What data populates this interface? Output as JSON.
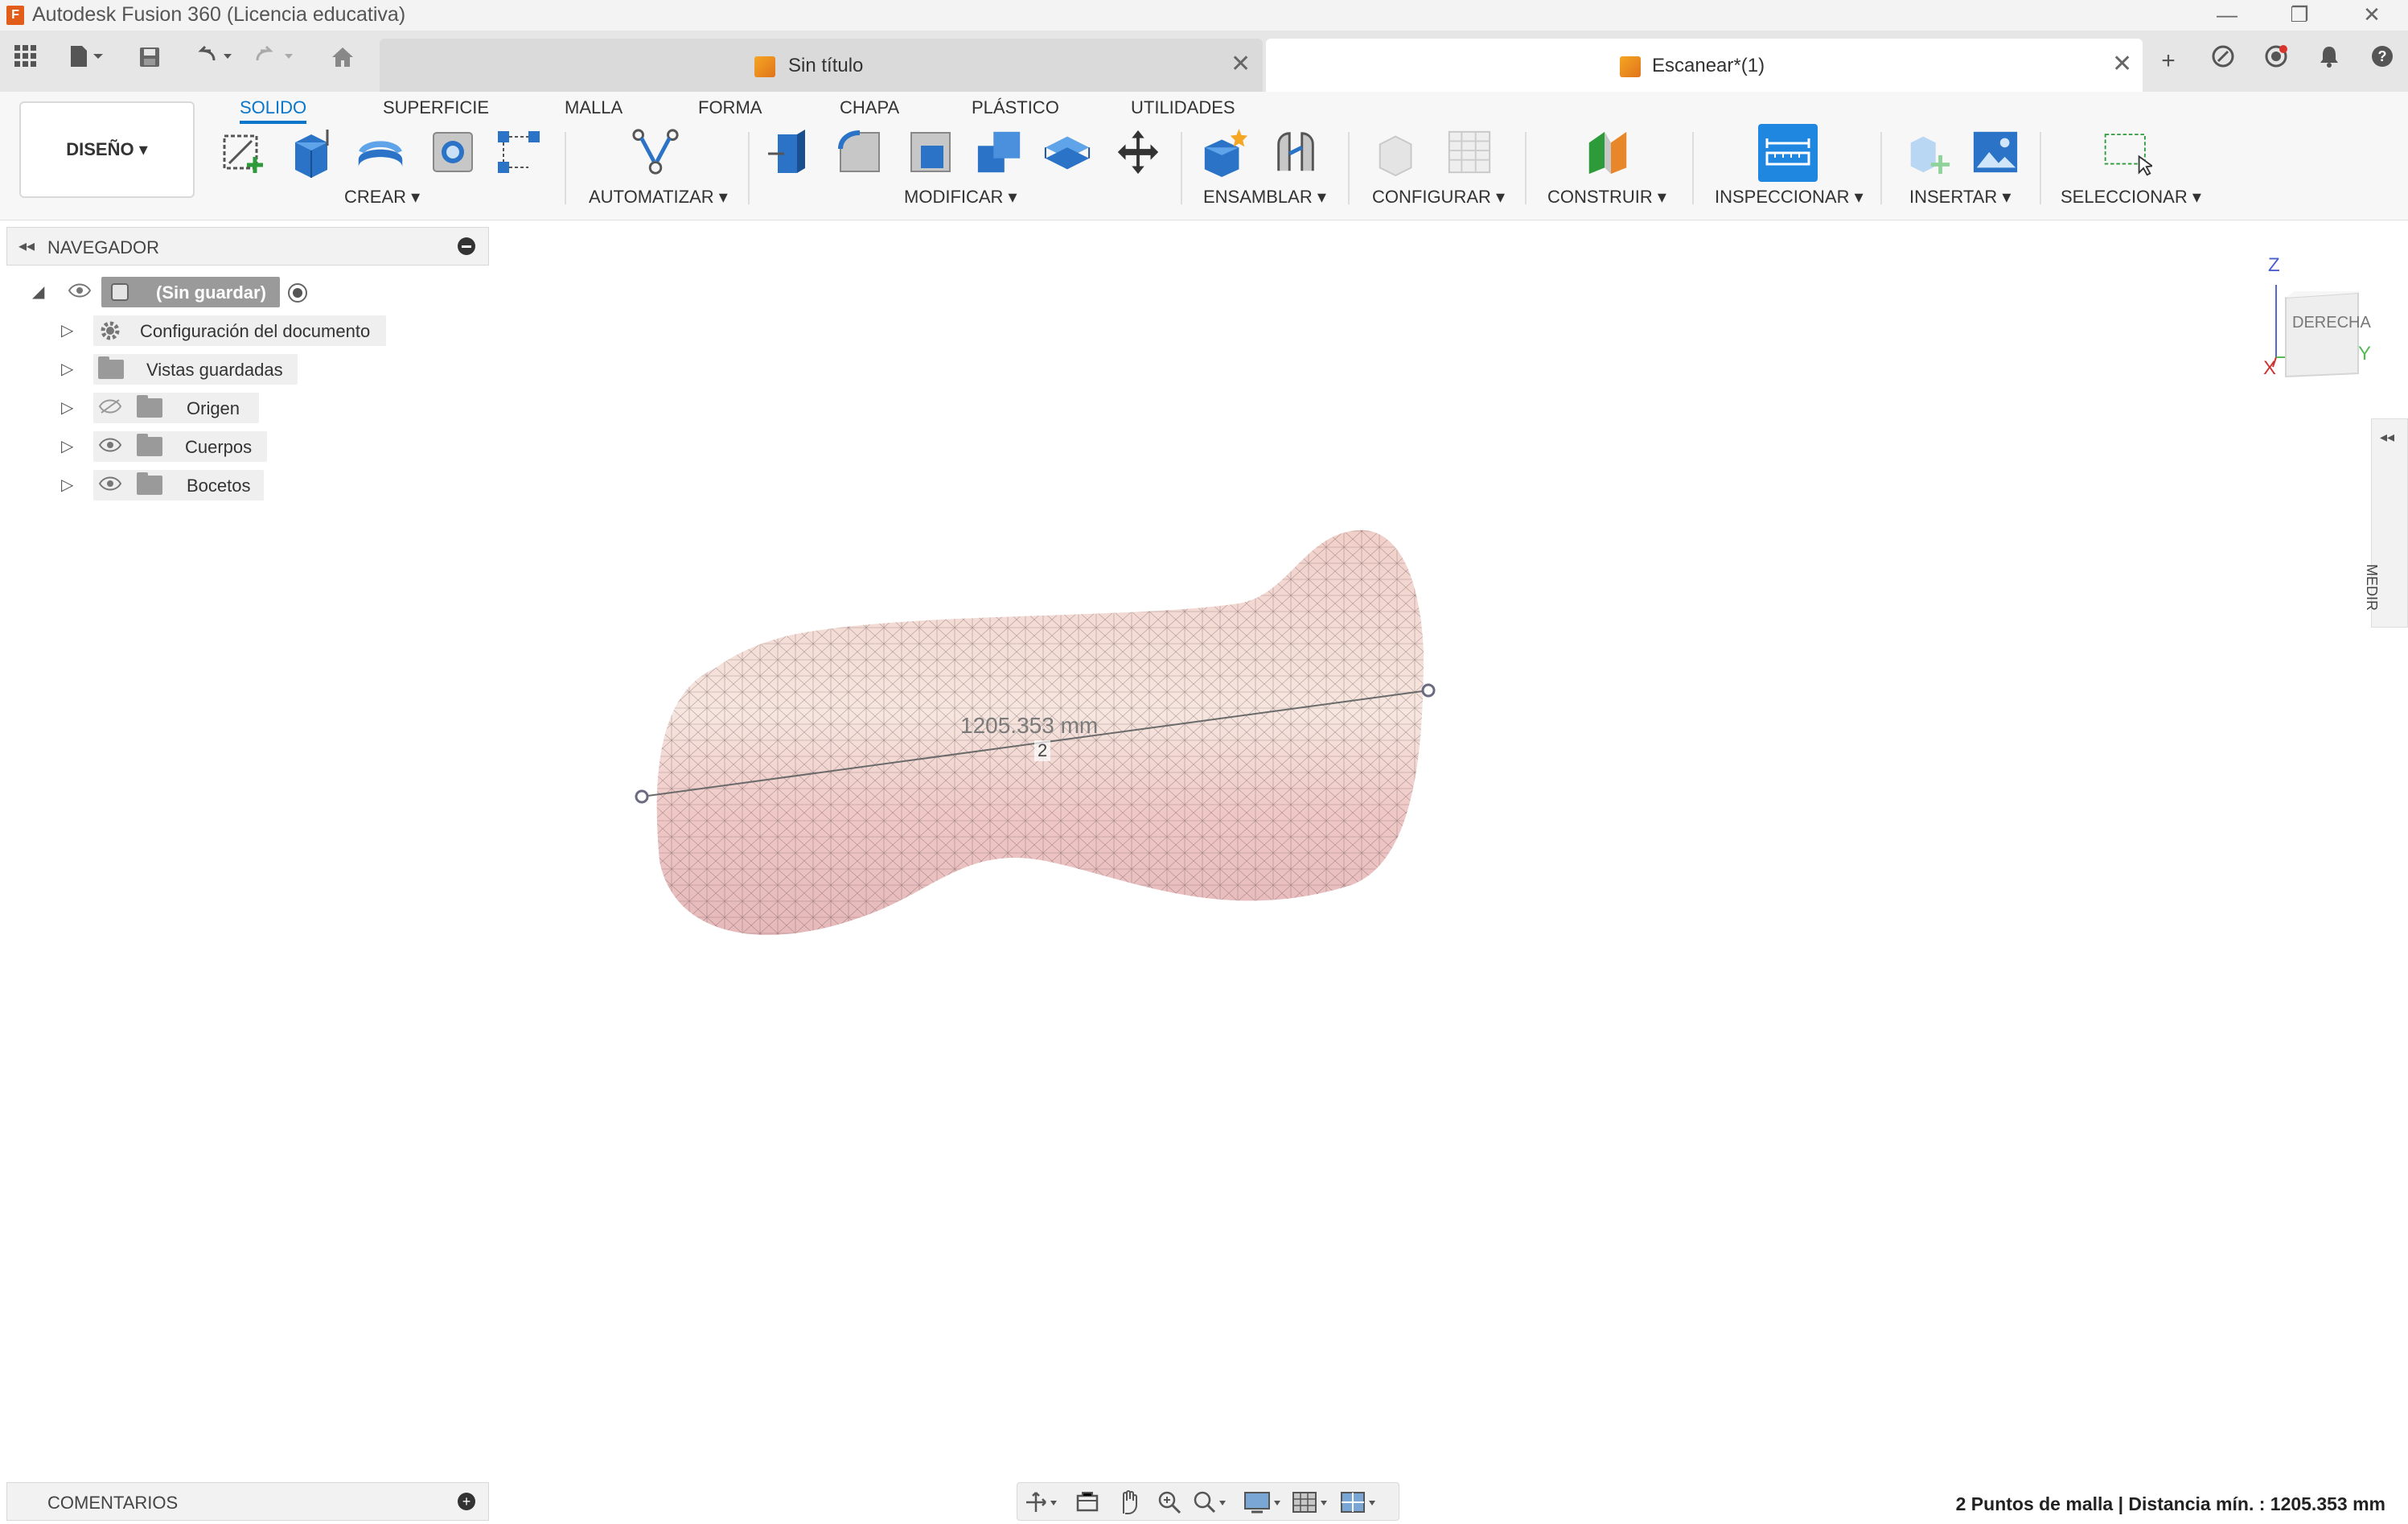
{
  "window": {
    "title": "Autodesk Fusion 360 (Licencia educativa)",
    "logo_letter": "F",
    "minimize": "—",
    "restore": "❐",
    "close": "✕"
  },
  "tabs": [
    {
      "label": "Sin título",
      "close": "✕",
      "active": false
    },
    {
      "label": "Escanear*(1)",
      "close": "✕",
      "active": true
    }
  ],
  "tabbar_right": {
    "new_tab": "+"
  },
  "ribbon": {
    "workspace": "DISEÑO ▾",
    "tabs": [
      "SOLIDO",
      "SUPERFICIE",
      "MALLA",
      "FORMA",
      "CHAPA",
      "PLÁSTICO",
      "UTILIDADES"
    ],
    "groups": {
      "crear": "CREAR ▾",
      "automatizar": "AUTOMATIZAR ▾",
      "modificar": "MODIFICAR ▾",
      "ensamblar": "ENSAMBLAR ▾",
      "configurar": "CONFIGURAR ▾",
      "construir": "CONSTRUIR ▾",
      "inspeccionar": "INSPECCIONAR ▾",
      "insertar": "INSERTAR ▾",
      "seleccionar": "SELECCIONAR ▾"
    },
    "colors": {
      "accent": "#0a76c9"
    }
  },
  "browser": {
    "title": "NAVEGADOR",
    "collapse": "◂◂",
    "root": "(Sin guardar)",
    "items": [
      {
        "label": "Configuración del documento"
      },
      {
        "label": "Vistas guardadas"
      },
      {
        "label": "Origen"
      },
      {
        "label": "Cuerpos"
      },
      {
        "label": "Bocetos"
      }
    ]
  },
  "viewcube": {
    "face": "DERECHA",
    "axis_z": "Z",
    "axis_x": "X",
    "axis_y": "Y"
  },
  "measure_panel": {
    "label": "MEDIR",
    "collapse": "◂◂"
  },
  "viewport": {
    "measure_value": "1205.353 mm",
    "point_count": "2"
  },
  "comments": {
    "label": "COMENTARIOS",
    "plus": "+"
  },
  "status": {
    "text": "2 Puntos de malla | Distancia mín. : 1205.353 mm"
  }
}
